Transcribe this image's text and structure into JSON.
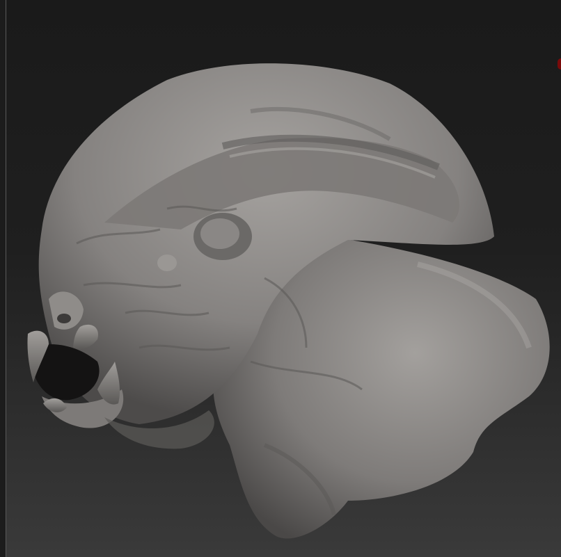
{
  "app": {
    "canvas": {
      "background_top": "#1a1a1a",
      "background_bottom": "#3a3a3a",
      "indicator_color": "#7a0a0a"
    },
    "model": {
      "description_icon": "sculpted-creature-head-icon",
      "material_color": "#8e8b88"
    }
  }
}
